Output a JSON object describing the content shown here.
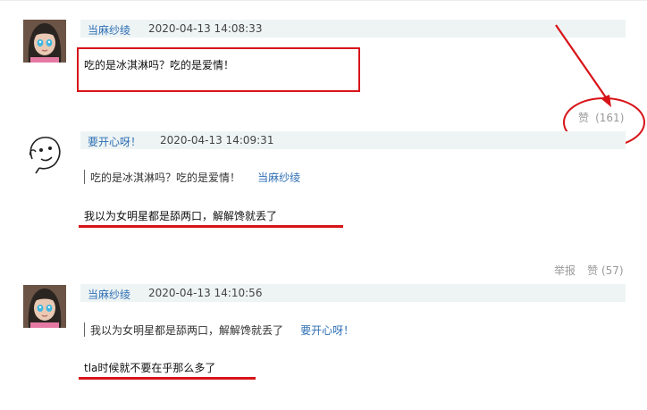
{
  "comments": [
    {
      "user": "当麻纱绫",
      "time": "2020-04-13 14:08:33",
      "text": "吃的是冰淇淋吗？吃的是爱情！",
      "like_label": "赞",
      "like_count": "(161)"
    },
    {
      "user": "要开心呀！",
      "time": "2020-04-13 14:09:31",
      "quote_text": "吃的是冰淇淋吗？吃的是爱情！",
      "quote_user": "当麻纱绫",
      "text": "我以为女明星都是舔两口，解解馋就丢了",
      "report_label": "举报",
      "like_label": "赞",
      "like_count": "(57)"
    },
    {
      "user": "当麻纱绫",
      "time": "2020-04-13 14:10:56",
      "quote_text": "我以为女明星都是舔两口，解解馋就丢了",
      "quote_user": "要开心呀！",
      "text": "tla时候就不要在乎那么多了"
    }
  ],
  "colors": {
    "annotation_red": "#d71418",
    "username_blue": "#2f6fb5",
    "meta_bg": "#eef4f4"
  },
  "icons": {
    "avatar_1": "anime-girl-avatar",
    "avatar_2": "doodle-face-avatar",
    "avatar_3": "anime-girl-avatar"
  }
}
